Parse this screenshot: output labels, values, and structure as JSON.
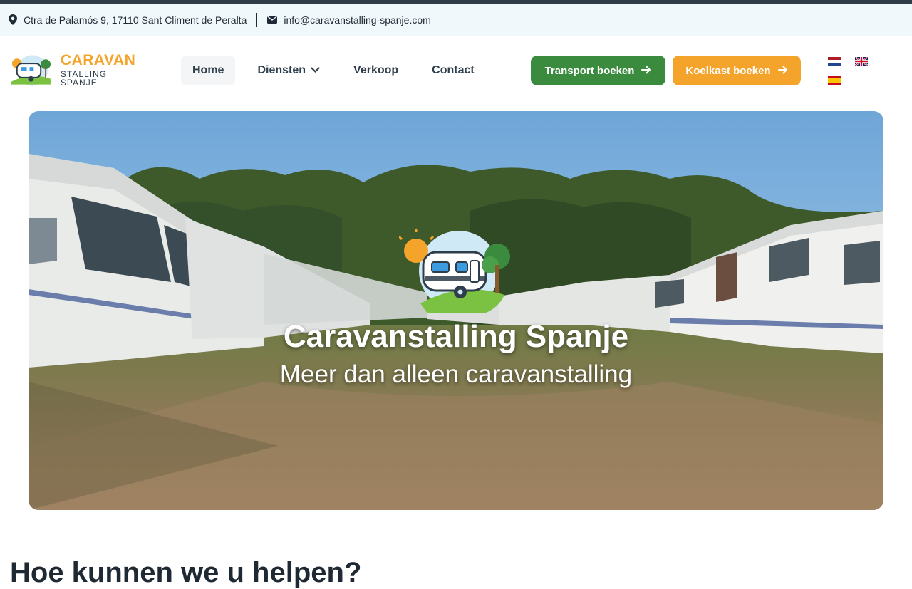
{
  "topbar": {
    "address": "Ctra de Palamós 9, 17110 Sant Climent de Peralta",
    "email": "info@caravanstalling-spanje.com",
    "address_icon": "map-pin-icon",
    "email_icon": "envelope-icon"
  },
  "logo": {
    "title": "CARAVAN",
    "subtitle": "STALLING SPANJE"
  },
  "nav": {
    "items": [
      {
        "label": "Home",
        "active": true
      },
      {
        "label": "Diensten",
        "has_dropdown": true
      },
      {
        "label": "Verkoop"
      },
      {
        "label": "Contact"
      }
    ]
  },
  "buttons": {
    "transport": "Transport boeken",
    "koelkast": "Koelkast boeken"
  },
  "languages": [
    "nl",
    "en",
    "es"
  ],
  "hero": {
    "title": "Caravanstalling Spanje",
    "subtitle": "Meer dan alleen caravanstalling"
  },
  "section": {
    "title": "Hoe kunnen we u helpen?"
  },
  "colors": {
    "accent_orange": "#f4a42a",
    "accent_green": "#3b8b3f",
    "topbar_bg": "#f1f8fc",
    "text_dark": "#2e3d4a"
  }
}
